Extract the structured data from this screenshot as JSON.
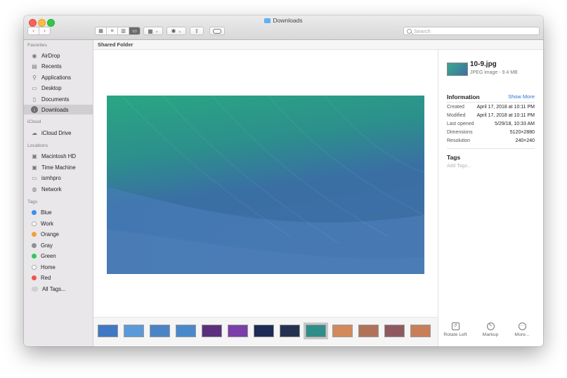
{
  "window": {
    "title": "Downloads",
    "colors": {
      "sidebar_selected": "#d0ced1",
      "accent": "#2a73d9"
    }
  },
  "toolbar": {
    "back_icon": "chevron-left-icon",
    "forward_icon": "chevron-right-icon",
    "view_modes": [
      "icon-view",
      "list-view",
      "column-view",
      "gallery-view"
    ],
    "active_view": "gallery-view",
    "search_placeholder": "Search"
  },
  "sidebar": {
    "favorites_label": "Favorites",
    "favorites": [
      {
        "label": "AirDrop",
        "icon": "airdrop-icon"
      },
      {
        "label": "Recents",
        "icon": "recents-icon"
      },
      {
        "label": "Applications",
        "icon": "applications-icon"
      },
      {
        "label": "Desktop",
        "icon": "desktop-icon"
      },
      {
        "label": "Documents",
        "icon": "documents-icon"
      },
      {
        "label": "Downloads",
        "icon": "downloads-icon",
        "selected": true
      }
    ],
    "icloud_label": "iCloud",
    "icloud": [
      {
        "label": "iCloud Drive",
        "icon": "cloud-icon"
      }
    ],
    "locations_label": "Locations",
    "locations": [
      {
        "label": "Macintosh HD",
        "icon": "disk-icon"
      },
      {
        "label": "Time Machine",
        "icon": "disk-icon"
      },
      {
        "label": "ismhpro",
        "icon": "computer-icon"
      },
      {
        "label": "Network",
        "icon": "network-icon"
      }
    ],
    "tags_label": "Tags",
    "tags": [
      {
        "label": "Blue",
        "color": "#3b8ff0"
      },
      {
        "label": "Work",
        "color": "#ffffff"
      },
      {
        "label": "Orange",
        "color": "#f5a03a"
      },
      {
        "label": "Gray",
        "color": "#8e8e93"
      },
      {
        "label": "Green",
        "color": "#35c759"
      },
      {
        "label": "Home",
        "color": "#ffffff"
      },
      {
        "label": "Red",
        "color": "#f2534a"
      },
      {
        "label": "All Tags...",
        "color": "#d0d0d0"
      }
    ]
  },
  "pathbar": {
    "label": "Shared Folder"
  },
  "info": {
    "file_name": "10-9.jpg",
    "file_kind": "JPEG image - 9.4 MB",
    "information_label": "Information",
    "show_more": "Show More",
    "rows": [
      {
        "k": "Created",
        "v": "April 17, 2018 at 10:11 PM"
      },
      {
        "k": "Modified",
        "v": "April 17, 2018 at 10:11 PM"
      },
      {
        "k": "Last opened",
        "v": "5/29/18, 10:33 AM"
      },
      {
        "k": "Dimensions",
        "v": "5120×2880"
      },
      {
        "k": "Resolution",
        "v": "240×240"
      }
    ],
    "tags_label": "Tags",
    "add_tags": "Add Tags...",
    "actions": [
      {
        "label": "Rotate Left",
        "icon": "rotate-left-icon"
      },
      {
        "label": "Markup",
        "icon": "markup-icon"
      },
      {
        "label": "More...",
        "icon": "more-icon"
      }
    ]
  },
  "thumbnails": [
    {
      "bg": "#3f78c4"
    },
    {
      "bg": "#5b9ad8"
    },
    {
      "bg": "#4b84c6"
    },
    {
      "bg": "#4a88cc"
    },
    {
      "bg": "#5a2f7c"
    },
    {
      "bg": "#7b3fa8"
    },
    {
      "bg": "#1c2a55"
    },
    {
      "bg": "#24324f"
    },
    {
      "bg": "#2f8d8a",
      "selected": true
    },
    {
      "bg": "#d28a5c"
    },
    {
      "bg": "#b07359"
    },
    {
      "bg": "#8e5a5f"
    },
    {
      "bg": "#c87f58"
    }
  ]
}
